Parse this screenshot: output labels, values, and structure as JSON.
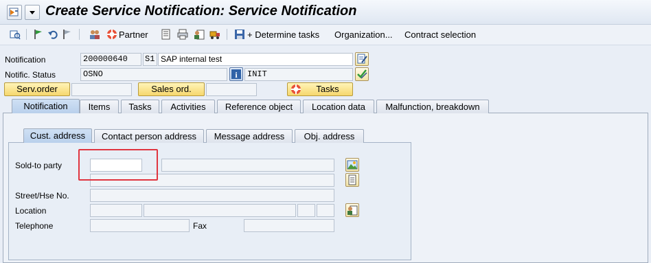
{
  "window": {
    "title": "Create Service Notification: Service Notification"
  },
  "toolbar": {
    "partner_label": "Partner",
    "determine_tasks_label": "+ Determine tasks",
    "organization_label": "Organization...",
    "contract_selection_label": "Contract selection"
  },
  "header": {
    "notification_label": "Notification",
    "notification_value": "200000640",
    "notification_type": "S1",
    "notification_desc": "SAP internal test",
    "status_label": "Notific. Status",
    "status_value": "OSNO",
    "status_init": "INIT",
    "servorder_label": "Serv.order",
    "salesord_label": "Sales ord.",
    "tasks_label": "Tasks"
  },
  "tabs": [
    {
      "label": "Notification"
    },
    {
      "label": "Items"
    },
    {
      "label": "Tasks"
    },
    {
      "label": "Activities"
    },
    {
      "label": "Reference object"
    },
    {
      "label": "Location data"
    },
    {
      "label": "Malfunction, breakdown"
    }
  ],
  "subtabs": [
    {
      "label": "Cust. address"
    },
    {
      "label": "Contact person address"
    },
    {
      "label": "Message address"
    },
    {
      "label": "Obj. address"
    }
  ],
  "address": {
    "soldto_label": "Sold-to party",
    "soldto_value": "",
    "street_label": "Street/Hse No.",
    "location_label": "Location",
    "telephone_label": "Telephone",
    "fax_label": "Fax"
  },
  "colors": {
    "highlight": "#e0343f",
    "button_yellow": "#f6d76e",
    "active_tab": "#cfe0f4"
  }
}
